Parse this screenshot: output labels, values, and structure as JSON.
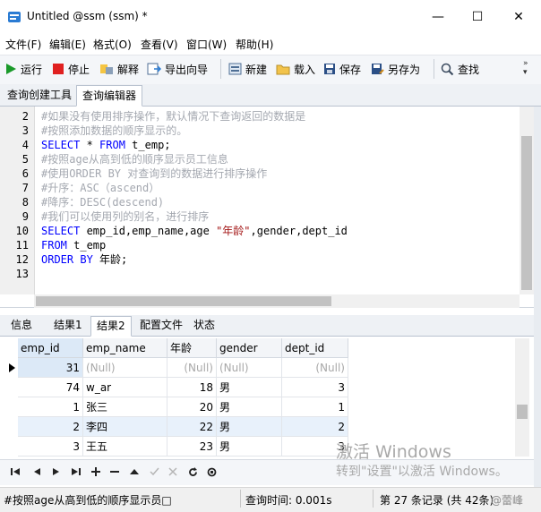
{
  "window": {
    "title": "Untitled @ssm (ssm) *",
    "minimize": "—",
    "maximize": "☐",
    "close": "✕"
  },
  "menu": [
    "文件(F)",
    "编辑(E)",
    "格式(O)",
    "查看(V)",
    "窗口(W)",
    "帮助(H)"
  ],
  "toolbar": {
    "run": "运行",
    "stop": "停止",
    "explain": "解释",
    "export_wizard": "导出向导",
    "new": "新建",
    "load": "载入",
    "save": "保存",
    "save_as": "另存为",
    "find": "查找"
  },
  "tabs": [
    "查询创建工具",
    "查询编辑器"
  ],
  "editor": {
    "lines": [
      {
        "n": "2",
        "text": "#如果没有使用排序操作，默认情况下查询返回的数据是"
      },
      {
        "n": "3",
        "text": "#按照添加数据的顺序显示的。"
      },
      {
        "n": "4",
        "text": "SELECT * FROM t_emp;"
      },
      {
        "n": "5",
        "text": "#按照age从高到低的顺序显示员工信息"
      },
      {
        "n": "6",
        "text": "#使用ORDER BY 对查询到的数据进行排序操作"
      },
      {
        "n": "7",
        "text": "#升序：ASC（ascend）"
      },
      {
        "n": "8",
        "text": "#降序：DESC(descend)"
      },
      {
        "n": "9",
        "text": "#我们可以使用列的别名，进行排序"
      },
      {
        "n": "10",
        "text": "SELECT emp_id,emp_name,age \"年龄\",gender,dept_id"
      },
      {
        "n": "11",
        "text": "FROM t_emp"
      },
      {
        "n": "12",
        "text": "ORDER BY 年龄;"
      },
      {
        "n": "13",
        "text": ""
      }
    ],
    "tokens": {
      "l4_select": "SELECT",
      "l4_mid": " * ",
      "l4_from": "FROM",
      "l4_rest": " t_emp;",
      "l10_select": "SELECT",
      "l10_mid": " emp_id,emp_name,age ",
      "l10_str": "\"年龄\"",
      "l10_rest": ",gender,dept_id",
      "l11_from": "FROM",
      "l11_rest": " t_emp",
      "l12_kw": "ORDER BY",
      "l12_rest": " 年龄;"
    }
  },
  "result_tabs": [
    "信息",
    "结果1",
    "结果2",
    "配置文件",
    "状态"
  ],
  "grid": {
    "columns": [
      "emp_id",
      "emp_name",
      "年龄",
      "gender",
      "dept_id"
    ],
    "rows": [
      [
        "31",
        "(Null)",
        "(Null)",
        "(Null)",
        "(Null)"
      ],
      [
        "74",
        "w_ar",
        "18",
        "男",
        "3"
      ],
      [
        "1",
        "张三",
        "20",
        "男",
        "1"
      ],
      [
        "2",
        "李四",
        "22",
        "男",
        "2"
      ],
      [
        "3",
        "王五",
        "23",
        "男",
        "3"
      ]
    ]
  },
  "watermark": {
    "line1": "激活 Windows",
    "line2": "转到\"设置\"以激活 Windows。"
  },
  "status": {
    "sql": "#按照age从高到低的顺序显示员□",
    "query_time": "查询时间: 0.001s",
    "record": "第 27 条记录 (共 42条)",
    "user": "@蕾峰"
  }
}
